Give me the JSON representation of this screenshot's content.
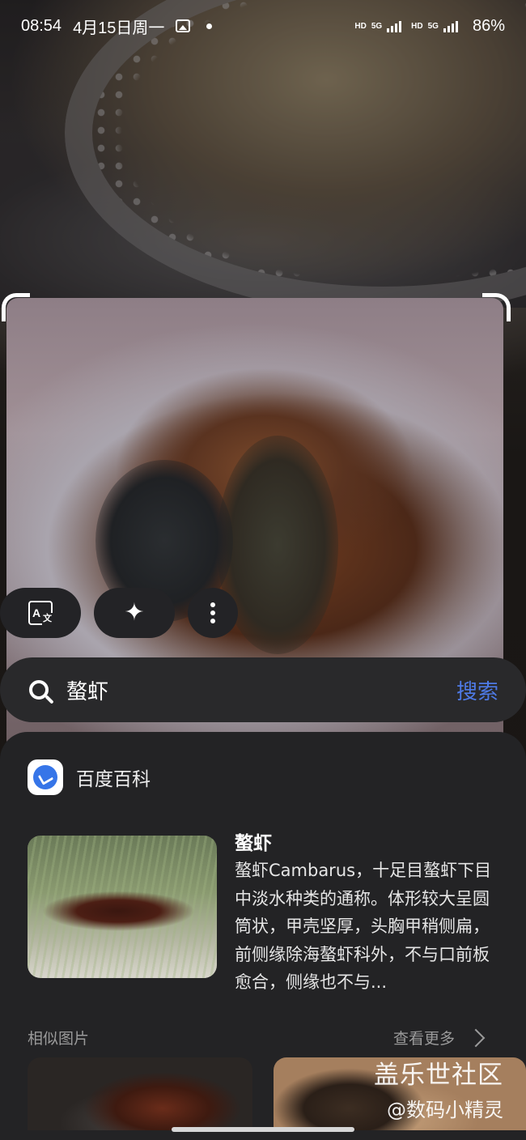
{
  "status_bar": {
    "time": "08:54",
    "date": "4月15日周一",
    "sim1": "HD",
    "net1": "5G",
    "sim2": "HD",
    "net2": "5G",
    "battery": "86%"
  },
  "actions": {
    "translate_icon": "translate-icon",
    "ai_icon": "sparkle-icon",
    "more_icon": "more-vertical-icon"
  },
  "search": {
    "query": "螯虾",
    "button_label": "搜索",
    "button_color": "#4e7ae6"
  },
  "result": {
    "source_name": "百度百科",
    "title": "螯虾",
    "description": "螯虾Cambarus，十足目螯虾下目中淡水种类的通称。体形较大呈圆筒状，甲壳坚厚，头胸甲稍侧扁，前侧缘除海螯虾科外，不与口前板愈合，侧缘也不与..."
  },
  "similar": {
    "label": "相似图片",
    "more_label": "查看更多"
  },
  "watermark": {
    "line1": "盖乐世社区",
    "line2": "@数码小精灵"
  }
}
